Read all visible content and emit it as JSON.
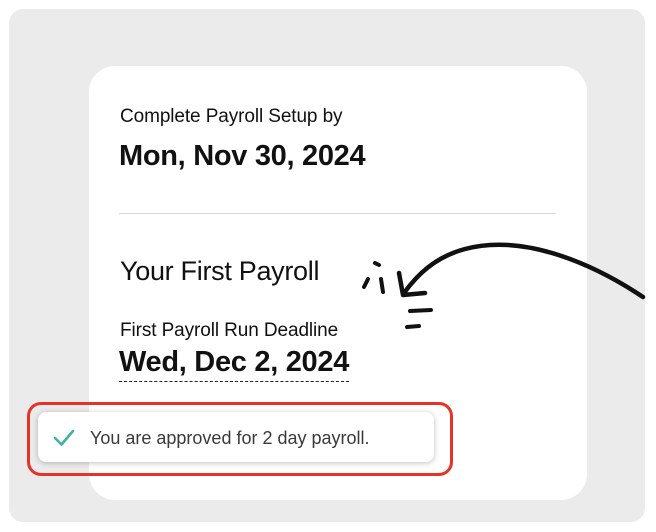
{
  "setup": {
    "label": "Complete Payroll Setup by",
    "date": "Mon, Nov 30, 2024"
  },
  "first_payroll": {
    "title": "Your First Payroll",
    "deadline_label": "First Payroll Run Deadline",
    "deadline_date": "Wed, Dec 2, 2024"
  },
  "toast": {
    "message": "You are approved for 2 day payroll.",
    "icon": "checkmark-icon",
    "icon_color": "#3fb3a3"
  },
  "annotation": {
    "highlight_color": "#e53327",
    "arrow_icon": "hand-drawn-arrow-icon"
  }
}
